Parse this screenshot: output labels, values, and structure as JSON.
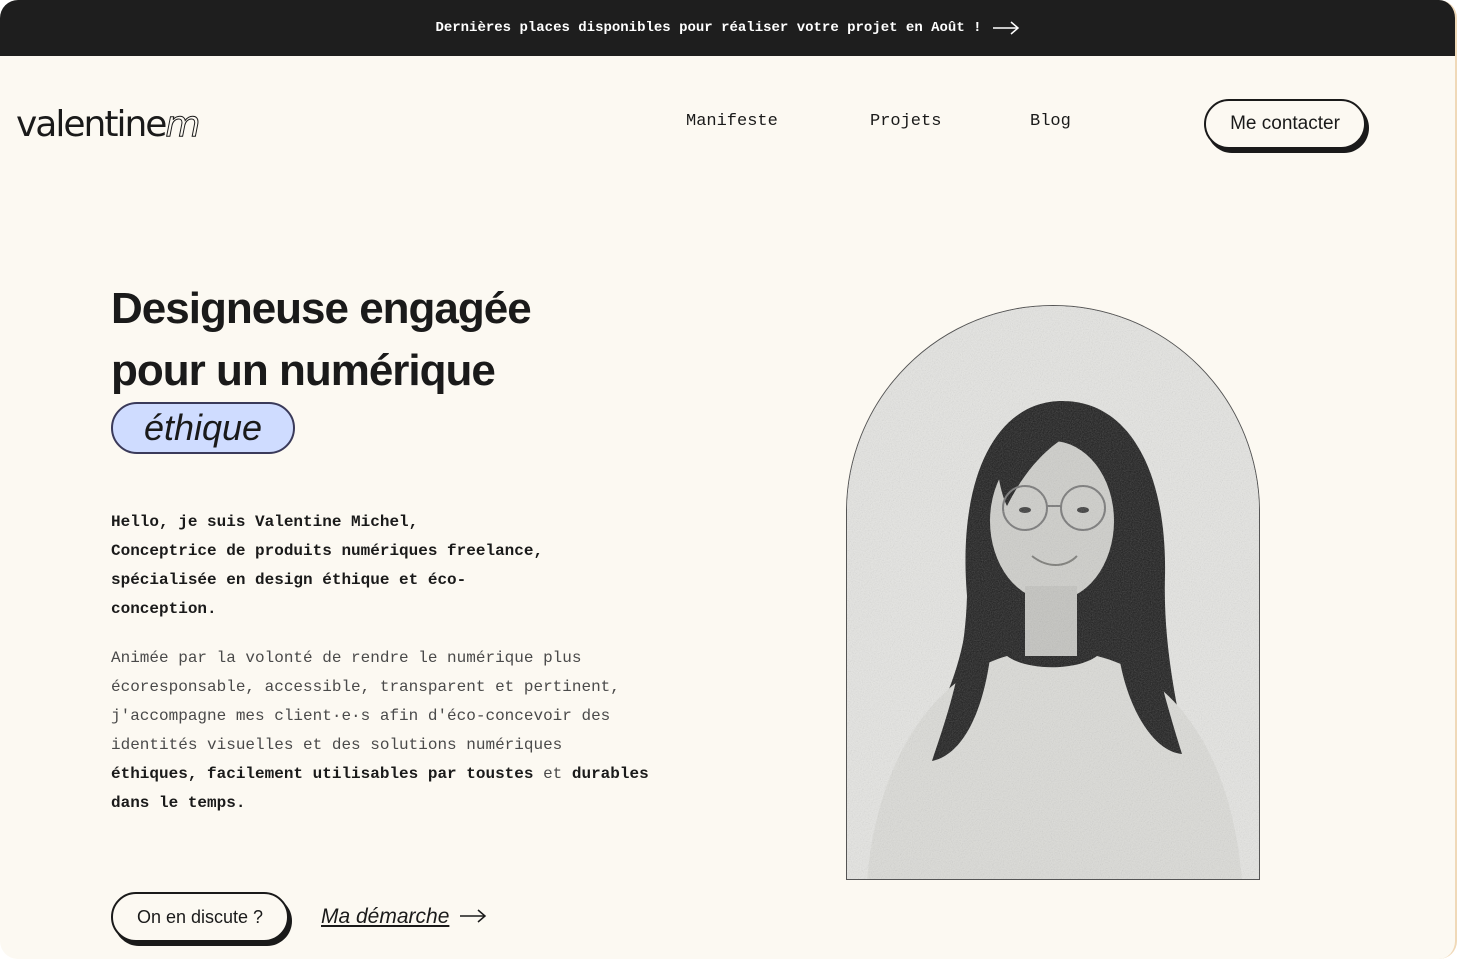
{
  "banner": {
    "text": "Dernières places disponibles pour réaliser votre projet en Août !",
    "arrow_icon": "arrow-right-icon"
  },
  "header": {
    "logo_main": "valentine",
    "logo_accent": "m",
    "nav": [
      {
        "label": "Manifeste"
      },
      {
        "label": "Projets"
      },
      {
        "label": "Blog"
      }
    ],
    "contact_label": "Me contacter"
  },
  "hero": {
    "title_line1": "Designeuse engagée",
    "title_line2": "pour un numérique",
    "highlight": "éthique",
    "highlight_color": "#cfdcff",
    "intro_lines": [
      "Hello, je suis Valentine Michel,",
      "Conceptrice de produits numériques freelance,",
      "spécialisée en design éthique et éco-",
      "conception."
    ],
    "desc": {
      "plain_1": "Animée par la volonté de rendre le numérique plus écoresponsable, accessible, transparent et pertinent, j'accompagne mes client·e·s afin d'éco-concevoir des identités visuelles et des solutions numériques ",
      "bold_1": "éthiques, facilement utilisables par toustes",
      "plain_2": " et ",
      "bold_2": "durables dans le temps."
    },
    "cta_label": "On en discute ?",
    "secondary_label": "Ma démarche",
    "secondary_icon": "arrow-right-icon"
  },
  "portrait": {
    "alt": "portrait-photo"
  }
}
